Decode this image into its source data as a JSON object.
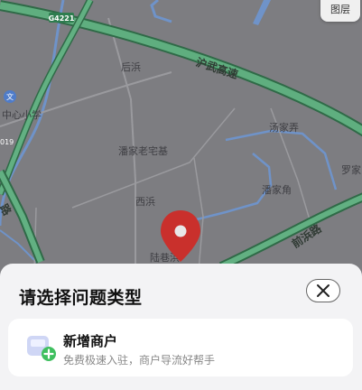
{
  "map": {
    "highway_tag": "G4221",
    "highway_name": "沪武高速",
    "road_tag": "019",
    "road_label": "前浜路",
    "road_label_left": "路",
    "places": {
      "houbang": "后浜",
      "zhongxin_school": "中心小学",
      "panjia_old_house": "潘家老宅基",
      "tangjia_lane": "汤家弄",
      "luo": "罗家",
      "panjia_jiao": "潘家角",
      "xibang": "西浜",
      "luxiang": "陆巷浜"
    },
    "layer_button_label": "图层",
    "colors": {
      "highway_fill": "#65b082",
      "road_border": "#4a9a6b",
      "water": "#6f93c9",
      "pin": "#c9302c"
    }
  },
  "sheet": {
    "title": "请选择问题类型",
    "close_icon": "close-icon",
    "options": [
      {
        "icon": "store-add-icon",
        "title": "新增商户",
        "subtitle": "免费极速入驻，商户导流好帮手"
      }
    ]
  }
}
